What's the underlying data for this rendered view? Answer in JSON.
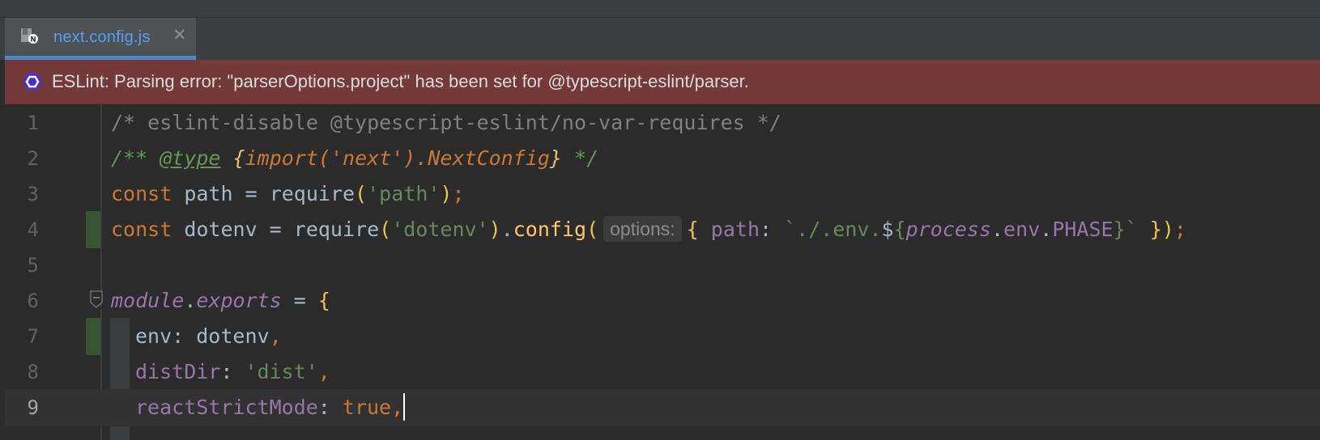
{
  "tab": {
    "filename": "next.config.js",
    "close_glyph": "✕",
    "file_badge": "N"
  },
  "error_banner": {
    "message": "ESLint: Parsing error: \"parserOptions.project\" has been set for @typescript-eslint/parser."
  },
  "editor": {
    "current_line": 9,
    "line_numbers": [
      "1",
      "2",
      "3",
      "4",
      "5",
      "6",
      "7",
      "8",
      "9"
    ],
    "lines": {
      "l1": {
        "comment": "/* eslint-disable @typescript-eslint/no-var-requires */"
      },
      "l2": {
        "open": "/** ",
        "tag": "@type",
        "space": " ",
        "type_open": "{",
        "type_body": "import('next').NextConfig",
        "type_close": "}",
        "close": " */"
      },
      "l3": {
        "kw": "const",
        "name": " path = ",
        "fn": "require",
        "p1": "(",
        "arg": "'path'",
        "p2": ")",
        "semi": ";"
      },
      "l4": {
        "kw": "const",
        "name": " dotenv = ",
        "fn": "require",
        "p1": "(",
        "arg": "'dotenv'",
        "p2": ")",
        "dot": ".",
        "method": "config",
        "p3": "(",
        "hint": "options:",
        "brace_open": "{",
        "key": " path",
        "colon": ": ",
        "tmpl_start": "`./.env.",
        "dollar": "$",
        "interp_open": "{",
        "process": "process",
        "dot2": ".",
        "env": "env",
        "dot3": ".",
        "phase": "PHASE",
        "interp_close": "}",
        "tmpl_end": "`",
        "brace_close": " }",
        "p4": ")",
        "semi": ";"
      },
      "l6": {
        "module": "module",
        "dot": ".",
        "exports": "exports",
        "eq": " = ",
        "brace": "{"
      },
      "l7": {
        "key": "env",
        "rest": ": dotenv",
        "comma": ","
      },
      "l8": {
        "key": "distDir",
        "colon": ": ",
        "val": "'dist'",
        "comma": ","
      },
      "l9": {
        "key": "reactStrictMode",
        "colon": ": ",
        "val": "true",
        "comma": ","
      }
    }
  },
  "colors": {
    "error_bg": "#743a3a",
    "tab_underline": "#4a88c7",
    "keyword": "#cc7832",
    "string": "#6a8759",
    "property": "#9876aa",
    "function": "#ffc66d"
  },
  "icons": [
    "js-file-icon",
    "close-icon",
    "eslint-icon",
    "fold-icon"
  ]
}
